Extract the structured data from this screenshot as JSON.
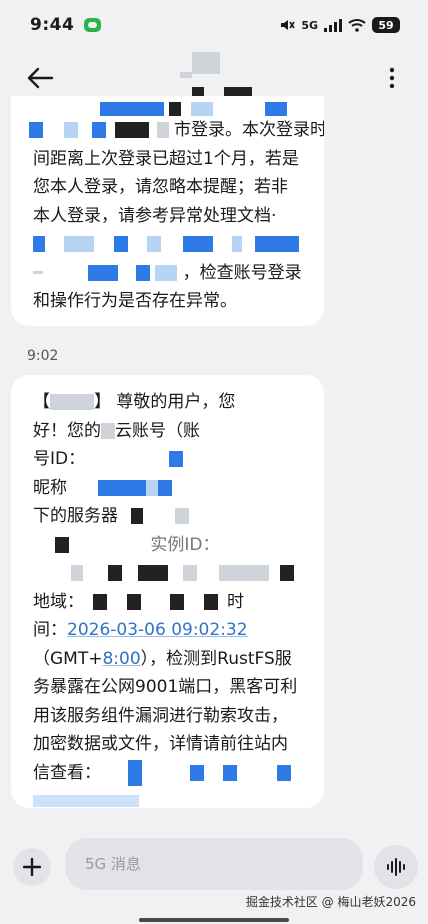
{
  "status_bar": {
    "time": "9:44",
    "network": "5G",
    "battery": "59",
    "icons": [
      "chat-bubble-icon",
      "mute-icon",
      "signal-icon",
      "wifi-icon",
      "battery-icon"
    ]
  },
  "header": {
    "back_icon": "arrow-left-icon",
    "more_icon": "more-vertical-icon"
  },
  "messages": [
    {
      "lines": [
        "市登录。本次登录时",
        "间距离上次登录已超过1个月，若是",
        "您本人登录，请忽略本提醒；若非",
        "本人登录，请参考异常处理文档·",
        "，检查账号登录",
        "和操作行为是否存在异常。"
      ]
    },
    {
      "time": "9:02",
      "bracket_open": "【",
      "bracket_close": "】",
      "greeting": "尊敬的用户，您",
      "line2a": "好！您的",
      "line2b": "云账号（账",
      "line3": "号ID：",
      "line4": "昵称",
      "line5": "下的服务器",
      "line6_fragment": "实例ID：",
      "line8a": "地域：",
      "line8b": "时",
      "line9a": "间：",
      "datetime": "2026-03-06 09:02:32",
      "line10a": "（GMT+",
      "tz": "8:00",
      "line10b": "），检测到RustFS服",
      "line11": "务暴露在公网9001端口，黑客可利",
      "line12": "用该服务组件漏洞进行勒索攻击，",
      "line13": "加密数据或文件，详情请前往站内",
      "line14": "信查看："
    }
  ],
  "composer": {
    "placeholder": "5G 消息",
    "plus_icon": "plus-icon",
    "voice_icon": "voice-wave-icon"
  },
  "watermark": "掘金技术社区 @ 梅山老妖2026",
  "colors": {
    "background": "#f1f1f4",
    "bubble": "#ffffff",
    "link": "#2f74c8",
    "mask_blue": "#2e7ae6",
    "mask_black": "#222222"
  }
}
